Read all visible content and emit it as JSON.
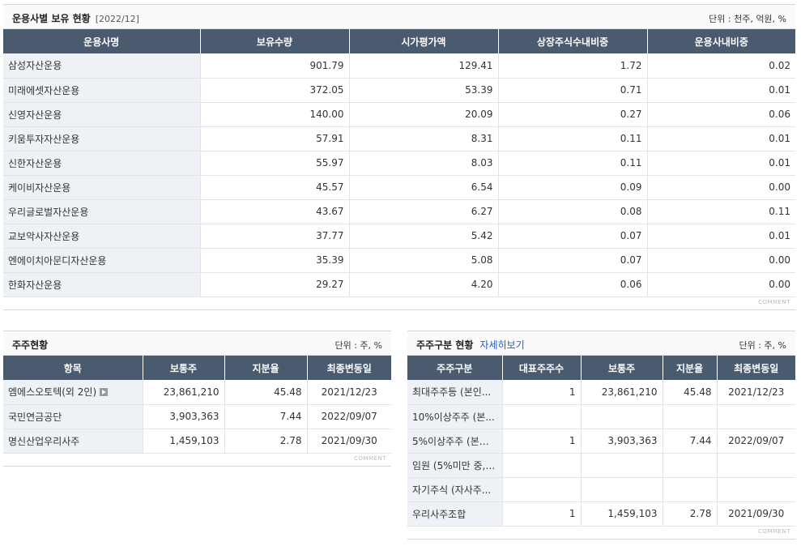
{
  "manager": {
    "title": "운용사별 보유 현황",
    "period": "[2022/12]",
    "unit": "단위 : 천주, 억원, %",
    "headers": [
      "운용사명",
      "보유수량",
      "시가평가액",
      "상장주식수내비중",
      "운용사내비중"
    ],
    "rows": [
      {
        "name": "삼성자산운용",
        "qty": "901.79",
        "value": "129.41",
        "listed_ratio": "1.72",
        "manager_ratio": "0.02"
      },
      {
        "name": "미래에셋자산운용",
        "qty": "372.05",
        "value": "53.39",
        "listed_ratio": "0.71",
        "manager_ratio": "0.01"
      },
      {
        "name": "신영자산운용",
        "qty": "140.00",
        "value": "20.09",
        "listed_ratio": "0.27",
        "manager_ratio": "0.06"
      },
      {
        "name": "키움투자자산운용",
        "qty": "57.91",
        "value": "8.31",
        "listed_ratio": "0.11",
        "manager_ratio": "0.01"
      },
      {
        "name": "신한자산운용",
        "qty": "55.97",
        "value": "8.03",
        "listed_ratio": "0.11",
        "manager_ratio": "0.01"
      },
      {
        "name": "케이비자산운용",
        "qty": "45.57",
        "value": "6.54",
        "listed_ratio": "0.09",
        "manager_ratio": "0.00"
      },
      {
        "name": "우리글로벌자산운용",
        "qty": "43.67",
        "value": "6.27",
        "listed_ratio": "0.08",
        "manager_ratio": "0.11"
      },
      {
        "name": "교보악사자산운용",
        "qty": "37.77",
        "value": "5.42",
        "listed_ratio": "0.07",
        "manager_ratio": "0.01"
      },
      {
        "name": "엔에이치아문디자산운용",
        "qty": "35.39",
        "value": "5.08",
        "listed_ratio": "0.07",
        "manager_ratio": "0.00"
      },
      {
        "name": "한화자산운용",
        "qty": "29.27",
        "value": "4.20",
        "listed_ratio": "0.06",
        "manager_ratio": "0.00"
      }
    ],
    "comment": "COMMENT"
  },
  "holders": {
    "title": "주주현황",
    "unit": "단위 : 주, %",
    "headers": [
      "항목",
      "보통주",
      "지분율",
      "최종변동일"
    ],
    "rows": [
      {
        "name": "엠에스오토텍(외 2인)",
        "common": "23,861,210",
        "share": "45.48",
        "date": "2021/12/23",
        "has_more": true
      },
      {
        "name": "국민연금공단",
        "common": "3,903,363",
        "share": "7.44",
        "date": "2022/09/07",
        "has_more": false
      },
      {
        "name": "명신산업우리사주",
        "common": "1,459,103",
        "share": "2.78",
        "date": "2021/09/30",
        "has_more": false
      }
    ],
    "comment": "COMMENT"
  },
  "holder_types": {
    "title": "주주구분 현황",
    "detail_link": "자세히보기",
    "unit": "단위 : 주, %",
    "headers": [
      "주주구분",
      "대표주주수",
      "보통주",
      "지분율",
      "최종변동일"
    ],
    "rows": [
      {
        "name": "최대주주등 (본인...",
        "count": "1",
        "common": "23,861,210",
        "share": "45.48",
        "date": "2021/12/23"
      },
      {
        "name": "10%이상주주 (본...",
        "count": "",
        "common": "",
        "share": "",
        "date": ""
      },
      {
        "name": "5%이상주주 (본인...",
        "count": "1",
        "common": "3,903,363",
        "share": "7.44",
        "date": "2022/09/07"
      },
      {
        "name": "임원 (5%미만 중, ...",
        "count": "",
        "common": "",
        "share": "",
        "date": ""
      },
      {
        "name": "자기주식 (자사주...",
        "count": "",
        "common": "",
        "share": "",
        "date": ""
      },
      {
        "name": "우리사주조합",
        "count": "1",
        "common": "1,459,103",
        "share": "2.78",
        "date": "2021/09/30"
      }
    ],
    "comment": "COMMENT"
  },
  "colors": {
    "header_bg": "#4a5a6f",
    "name_cell_bg": "#eef2f6",
    "link": "#2a5cb8"
  }
}
